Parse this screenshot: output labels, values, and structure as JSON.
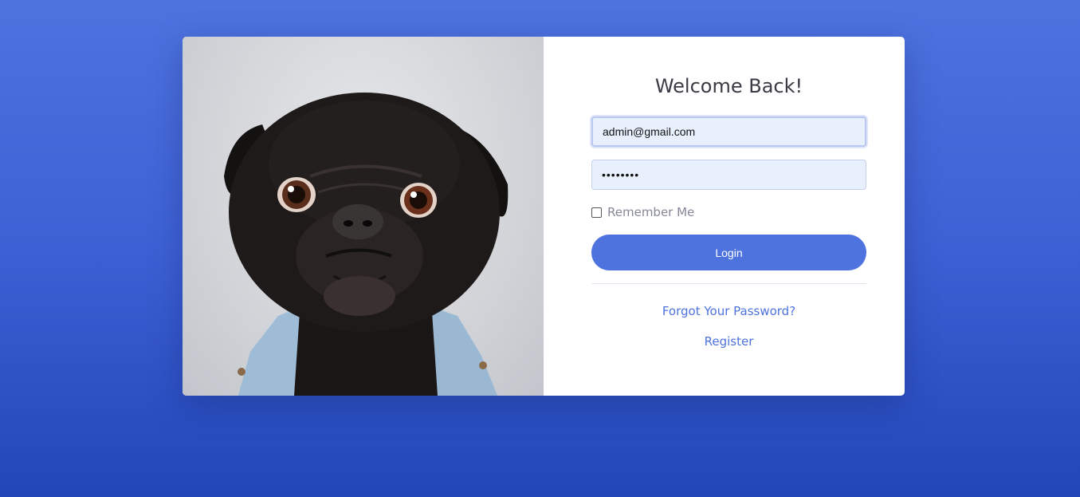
{
  "page": {
    "background_color": "#4e73df",
    "accent_color": "#4e73df"
  },
  "image": {
    "subject": "pug-in-denim-jacket"
  },
  "login": {
    "title": "Welcome Back!",
    "email_value": "admin@gmail.com",
    "password_value": "••••••••",
    "remember_label": "Remember Me",
    "remember_checked": false,
    "login_label": "Login",
    "forgot_label": "Forgot Your Password?",
    "register_label": "Register"
  }
}
